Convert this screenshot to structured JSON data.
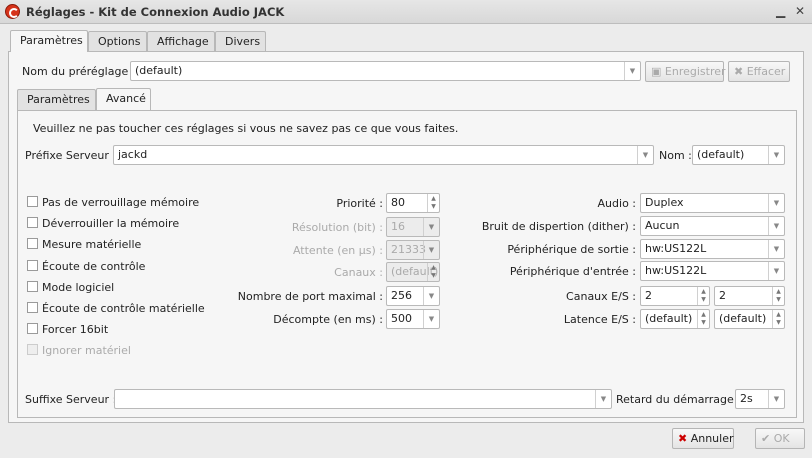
{
  "window": {
    "title": "Réglages - Kit de Connexion Audio JACK"
  },
  "outer_tabs": [
    "Paramètres",
    "Options",
    "Affichage",
    "Divers"
  ],
  "preset": {
    "label": "Nom du préréglage :",
    "value": "(default)",
    "save": "Enregistrer",
    "delete": "Effacer"
  },
  "inner_tabs": [
    "Paramètres",
    "Avancé"
  ],
  "warning": "Veuillez ne pas toucher ces réglages si vous ne savez pas ce que vous faites.",
  "prefix": {
    "label": "Préfixe Serveur :",
    "value": "jackd",
    "name_label": "Nom :",
    "name_value": "(default)"
  },
  "checkboxes": [
    {
      "label": "Pas de verrouillage mémoire",
      "enabled": true
    },
    {
      "label": "Déverrouiller la mémoire",
      "enabled": true
    },
    {
      "label": "Mesure matérielle",
      "enabled": true
    },
    {
      "label": "Écoute de contrôle",
      "enabled": true
    },
    {
      "label": "Mode logiciel",
      "enabled": true
    },
    {
      "label": "Écoute de contrôle matérielle",
      "enabled": true
    },
    {
      "label": "Forcer 16bit",
      "enabled": true
    },
    {
      "label": "Ignorer matériel",
      "enabled": false
    }
  ],
  "middle": [
    {
      "label": "Priorité :",
      "value": "80",
      "type": "spin",
      "enabled": true
    },
    {
      "label": "Résolution (bit) :",
      "value": "16",
      "type": "combo",
      "enabled": false
    },
    {
      "label": "Attente (en µs) :",
      "value": "21333",
      "type": "combo",
      "enabled": false
    },
    {
      "label": "Canaux :",
      "value": "(default)",
      "type": "spin",
      "enabled": false
    },
    {
      "label": "Nombre de port maximal :",
      "value": "256",
      "type": "combo",
      "enabled": true
    },
    {
      "label": "Décompte (en ms) :",
      "value": "500",
      "type": "combo",
      "enabled": true
    }
  ],
  "right": [
    {
      "label": "Audio :",
      "value": "Duplex"
    },
    {
      "label": "Bruit de dispertion (dither) :",
      "value": "Aucun"
    },
    {
      "label": "Périphérique de sortie :",
      "value": "hw:US122L"
    },
    {
      "label": "Périphérique d'entrée :",
      "value": "hw:US122L"
    }
  ],
  "channels": {
    "label": "Canaux E/S :",
    "in": "2",
    "out": "2"
  },
  "latency": {
    "label": "Latence E/S :",
    "in": "(default)",
    "out": "(default)"
  },
  "suffix": {
    "label": "Suffixe Serveur :",
    "value": "",
    "delay_label": "Retard du démarrage :",
    "delay_value": "2s"
  },
  "buttons": {
    "cancel": "Annuler",
    "ok": "OK"
  }
}
